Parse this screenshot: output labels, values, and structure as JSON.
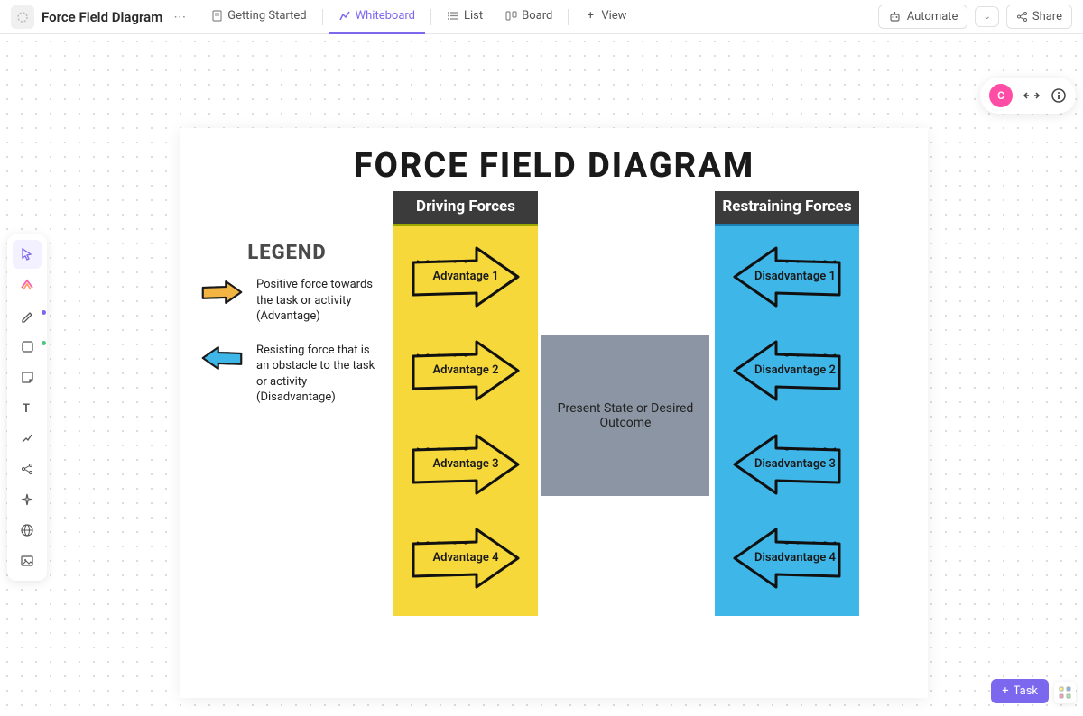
{
  "header": {
    "title": "Force Field Diagram",
    "tabs": {
      "getting_started": "Getting Started",
      "whiteboard": "Whiteboard",
      "list": "List",
      "board": "Board",
      "view": "View"
    },
    "automate": "Automate",
    "share": "Share"
  },
  "avatar": {
    "initial": "C"
  },
  "board": {
    "title": "FORCE FIELD  DIAGRAM",
    "legend": {
      "title": "LEGEND",
      "positive": "Positive force towards the task or activity (Advantage)",
      "resisting": "Resisting force that is an obstacle to the task or activity (Disadvantage)"
    },
    "driving_header": "Driving Forces",
    "restraining_header": "Restraining Forces",
    "advantages": [
      "Advantage 1",
      "Advantage 2",
      "Advantage 3",
      "Advantage 4"
    ],
    "disadvantages": [
      "Disadvantage 1",
      "Disadvantage 2",
      "Disadvantage 3",
      "Disadvantage 4"
    ],
    "center": "Present State or Desired Outcome"
  },
  "task_btn": "Task"
}
